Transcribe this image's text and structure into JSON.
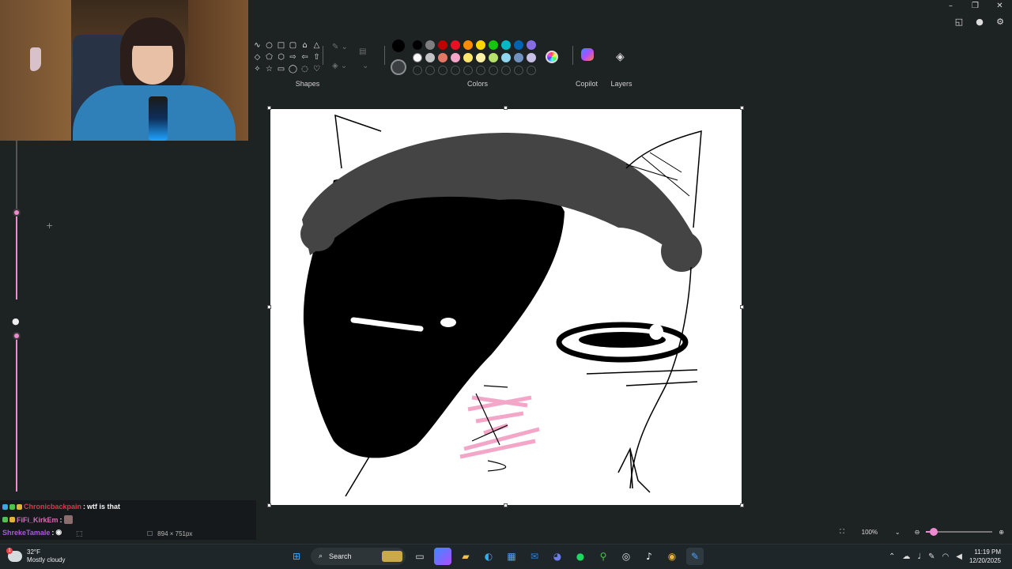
{
  "window": {
    "controls": [
      "minimize",
      "restore",
      "close"
    ]
  },
  "ribbon": {
    "shapes_label": "Shapes",
    "colors_label": "Colors",
    "copilot_label": "Copilot",
    "layers_label": "Layers",
    "shape_icons": [
      "curve-icon",
      "oval-icon",
      "rectangle-icon",
      "rounded-rectangle-icon",
      "polygon-icon",
      "triangle-icon",
      "diamond-icon",
      "pentagon-icon",
      "hexagon-icon",
      "right-arrow-icon",
      "left-arrow-icon",
      "up-arrow-icon",
      "four-point-star-icon",
      "five-point-star-icon",
      "speech-bubble-rect-icon",
      "speech-bubble-oval-icon",
      "thought-bubble-icon",
      "heart-icon"
    ],
    "current_color": "#000000",
    "palette_row1": [
      "#000000",
      "#7f7f7f",
      "#c00000",
      "#e81123",
      "#ff8c00",
      "#ffd700",
      "#16c60c",
      "#00b7c3",
      "#0063b1",
      "#886ce4"
    ],
    "palette_row2": [
      "#ffffff",
      "#c3c3c3",
      "#e47866",
      "#f4a6c9",
      "#ffe66d",
      "#fff2a8",
      "#b4e26b",
      "#8fd6ee",
      "#7092be",
      "#c8bfe7"
    ],
    "palette_row3_empty": 10
  },
  "chat": {
    "lines": [
      {
        "user": "Chronicbackpain",
        "sep": ":",
        "message": "wtf is that",
        "color": "#d63a4f"
      },
      {
        "user": "FiFi_KirkEm",
        "sep": ":",
        "message": "",
        "color": "#d86ab7"
      },
      {
        "user": "ShrekeTamale",
        "sep": ":",
        "message": "",
        "color": "#a65ad8"
      }
    ]
  },
  "status": {
    "canvas_size": "894 × 751px",
    "zoom": "100%",
    "zoom_fraction": 0.12
  },
  "taskbar": {
    "weather_temp": "32°F",
    "weather_desc": "Mostly cloudy",
    "weather_badge": "1",
    "search_placeholder": "Search",
    "time": "11:19 PM",
    "date": "12/20/2025"
  }
}
